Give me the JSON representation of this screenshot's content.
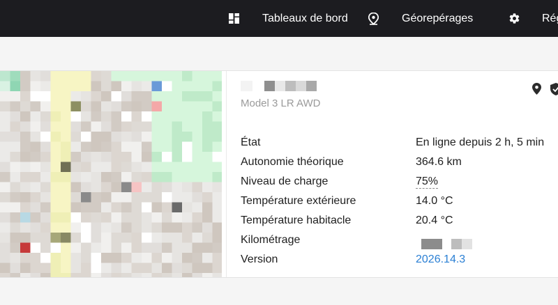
{
  "navbar": {
    "items": [
      {
        "icon": "dashboard-icon",
        "label": "Tableaux de bord"
      },
      {
        "icon": "geofence-pin-icon",
        "label": "Géorepérages"
      },
      {
        "icon": "gear-icon",
        "label": "Régl"
      }
    ]
  },
  "vehicle": {
    "model": "Model 3 LR AWD",
    "stats": [
      {
        "label": "État",
        "value": "En ligne depuis 2 h, 5 min"
      },
      {
        "label": "Autonomie théorique",
        "value": "364.6 km"
      },
      {
        "label": "Niveau de charge",
        "value": "75%"
      },
      {
        "label": "Température extérieure",
        "value": "14.0 °C"
      },
      {
        "label": "Température habitacle",
        "value": "20.4 °C"
      },
      {
        "label": "Kilométrage",
        "value": ""
      },
      {
        "label": "Version",
        "value": "2026.14.3"
      }
    ]
  },
  "colors": {
    "navbar_bg": "#1c1c20",
    "link": "#2a7fd4",
    "text": "#202020",
    "muted": "#9a9a9a"
  }
}
